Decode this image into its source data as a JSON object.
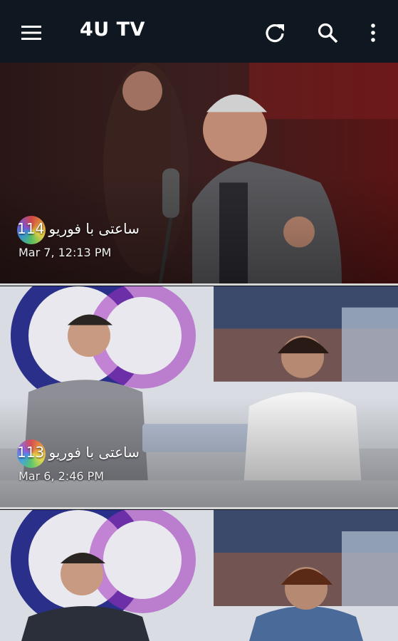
{
  "app": {
    "title": "4U TV"
  },
  "toolbar": {
    "menu_icon": "menu-icon",
    "refresh_icon": "refresh-icon",
    "search_icon": "search-icon",
    "more_icon": "more-vert-icon"
  },
  "colors": {
    "appbar": "#0f1720",
    "text": "#ffffff",
    "divider": "#d6d6d6"
  },
  "videos": [
    {
      "title": "ساعتی با فوریو 114",
      "date": "Mar 7, 12:13 PM"
    },
    {
      "title": "ساعتی با فوریو 113",
      "date": "Mar 6, 2:46 PM"
    },
    {
      "title": "",
      "date": ""
    }
  ]
}
